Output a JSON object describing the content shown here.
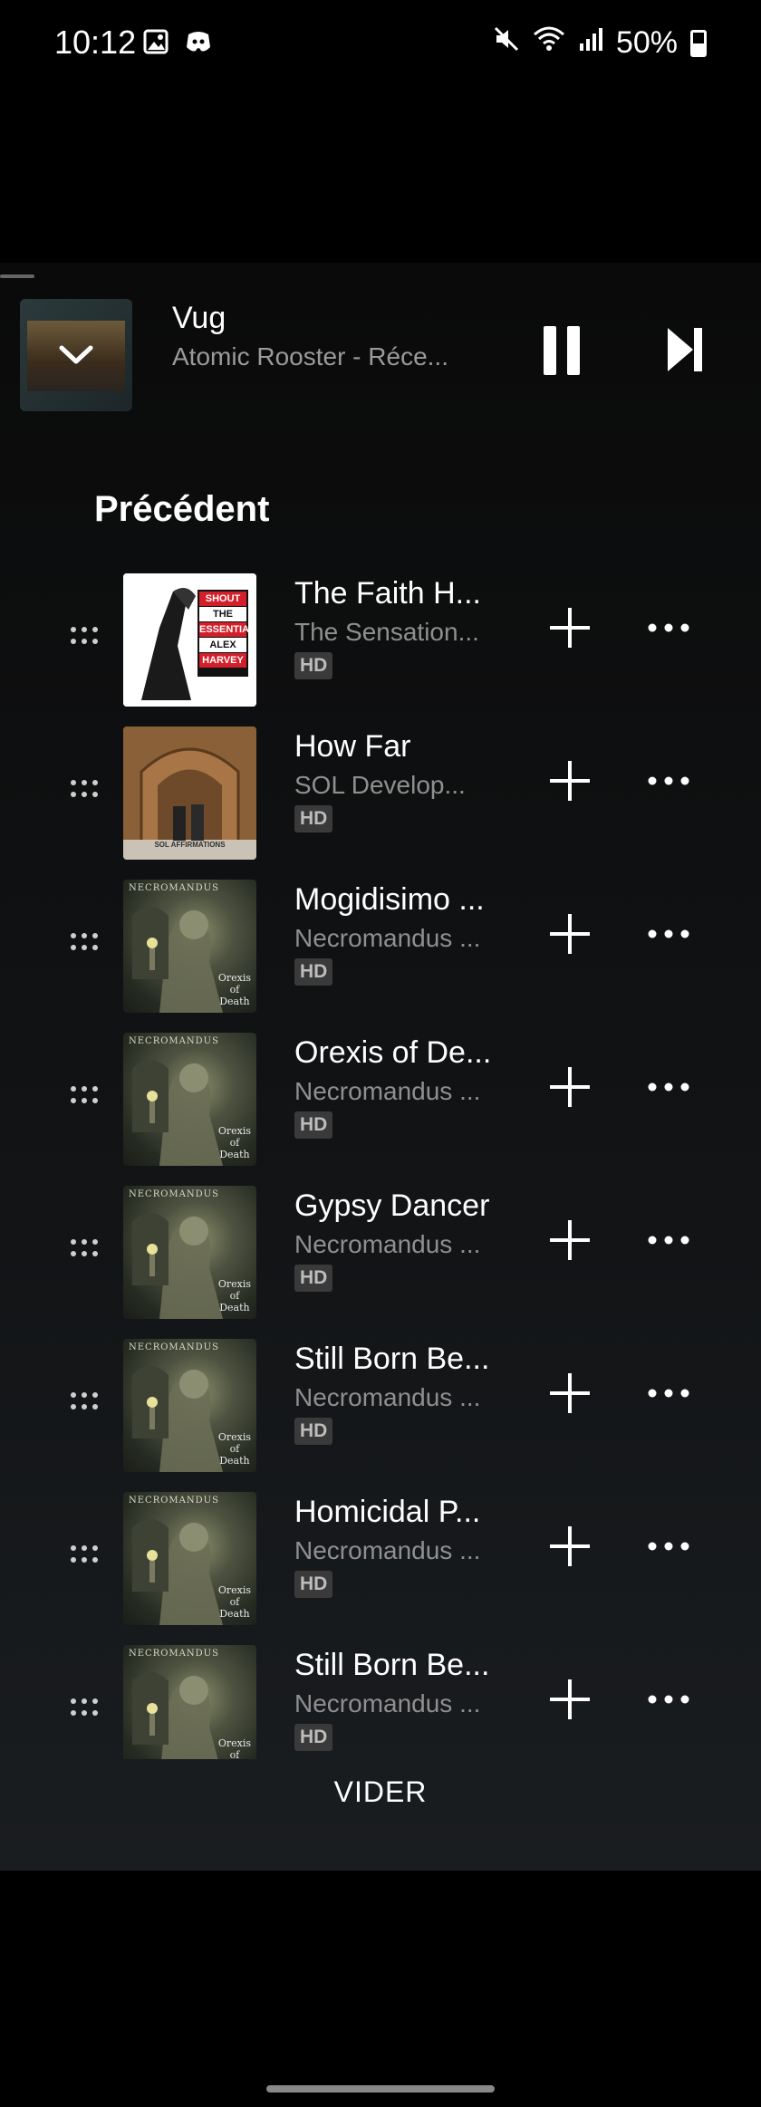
{
  "status_bar": {
    "time": "10:12",
    "battery": "50%",
    "battery_level": 0.5
  },
  "mini_player": {
    "title": "Vug",
    "subtitle": "Atomic Rooster - Réce..."
  },
  "queue": {
    "section_title": "Précédent",
    "clear_label": "VIDER",
    "tracks": [
      {
        "title": "The Faith H...",
        "artist": "The Sensation...",
        "badge": "HD",
        "art": "sahb"
      },
      {
        "title": "How Far",
        "artist": "SOL Develop...",
        "badge": "HD",
        "art": "sol"
      },
      {
        "title": "Mogidisimo ...",
        "artist": "Necromandus ...",
        "badge": "HD",
        "art": "necro"
      },
      {
        "title": "Orexis of De...",
        "artist": "Necromandus ...",
        "badge": "HD",
        "art": "necro"
      },
      {
        "title": "Gypsy Dancer",
        "artist": "Necromandus ...",
        "badge": "HD",
        "art": "necro"
      },
      {
        "title": "Still Born Be...",
        "artist": "Necromandus ...",
        "badge": "HD",
        "art": "necro"
      },
      {
        "title": "Homicidal P...",
        "artist": "Necromandus ...",
        "badge": "HD",
        "art": "necro"
      },
      {
        "title": "Still Born Be...",
        "artist": "Necromandus ...",
        "badge": "HD",
        "art": "necro"
      }
    ]
  },
  "album_art_text": {
    "sahb": [
      "SHOUT",
      "THE",
      "ESSENTIAL",
      "ALEX",
      "HARVEY"
    ],
    "sol": "SOL AFFIRMATIONS",
    "necro_band": "NECROMANDUS",
    "necro_album": [
      "Orexis",
      "of",
      "Death"
    ]
  },
  "icons": {
    "status_left": [
      "gallery-icon",
      "discord-icon"
    ],
    "status_right": [
      "mute-icon",
      "wifi-icon",
      "signal-icon",
      "battery-icon"
    ],
    "mini_player": [
      "chevron-down-icon",
      "pause-icon",
      "skip-next-icon"
    ],
    "track_row": [
      "drag-handle-icon",
      "plus-icon",
      "more-icon"
    ]
  }
}
